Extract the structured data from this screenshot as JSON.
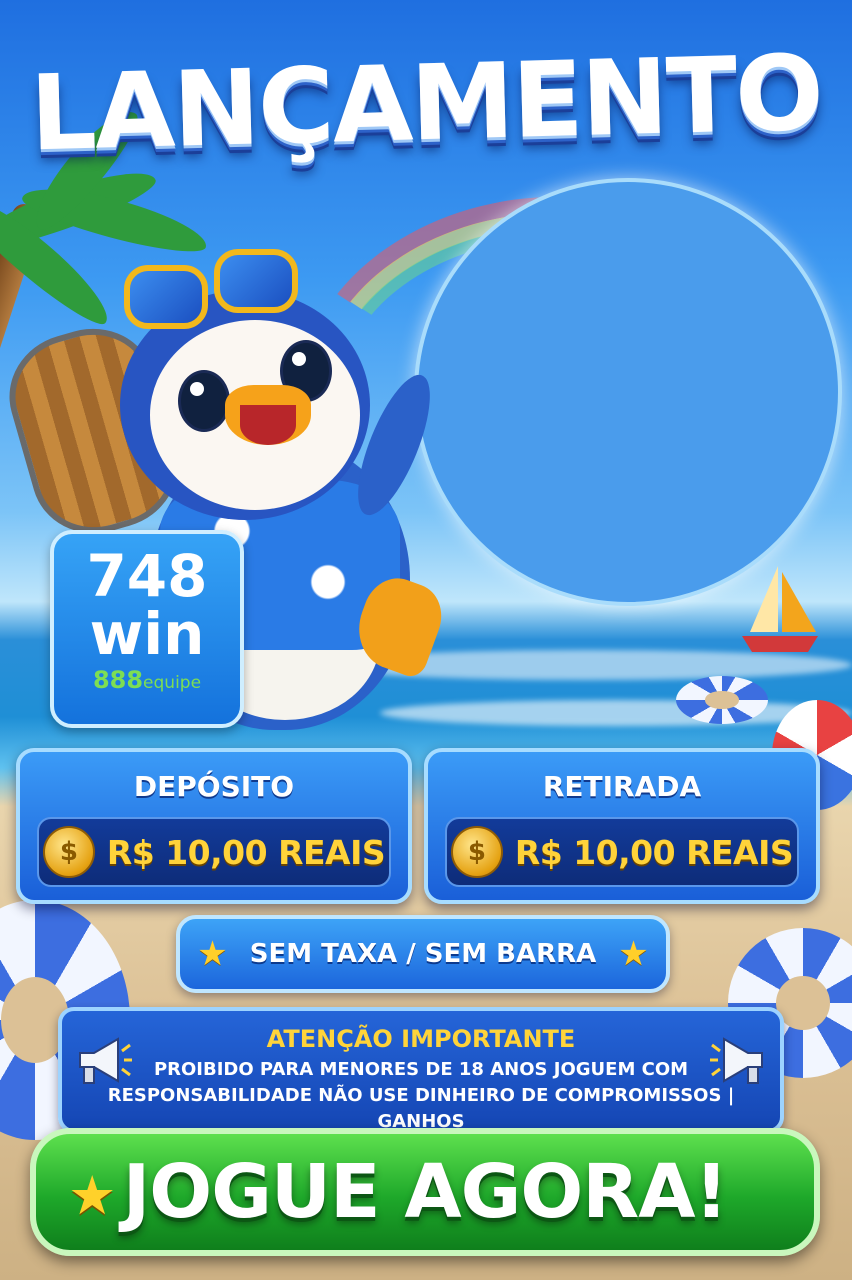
{
  "title": "LANÇAMENTO",
  "logo": {
    "line1": "748",
    "line2": "win",
    "brand_strong": "888",
    "brand_light": "equipe"
  },
  "deposit": {
    "title": "DEPÓSITO",
    "coin_symbol": "$",
    "amount": "R$ 10,00 REAIS"
  },
  "withdraw": {
    "title": "RETIRADA",
    "coin_symbol": "$",
    "amount": "R$ 10,00 REAIS"
  },
  "badge": {
    "text": "SEM TAXA / SEM BARRA",
    "star": "★"
  },
  "warning": {
    "title": "ATENÇÃO IMPORTANTE",
    "line1": "PROIBIDO PARA MENORES DE 18 ANOS JOGUEM COM",
    "line2": "RESPONSABILIDADE NÃO USE DINHEIRO DE COMPROMISSOS | GANHOS"
  },
  "cta": {
    "label": "JOGUE AGORA!",
    "star": "★"
  },
  "colors": {
    "cta_green": "#1ea82a",
    "amount_gold": "#ffd33a",
    "box_blue": "#1a5fd8",
    "photo_placeholder": "#4a9cec"
  },
  "icons": [
    "star-icon",
    "coin-icon",
    "megaphone-icon"
  ]
}
